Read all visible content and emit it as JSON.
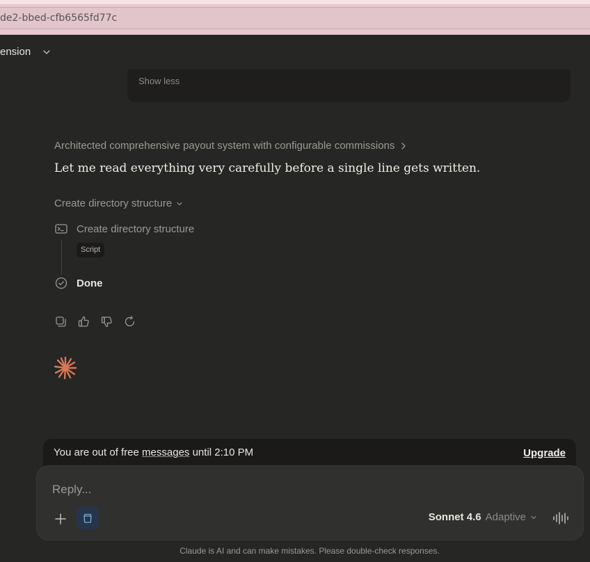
{
  "browser": {
    "url_fragment": "de2-bbed-cfb6565fd77c"
  },
  "header": {
    "project_label": "ension"
  },
  "previous_message": {
    "show_less_label": "Show less"
  },
  "assistant": {
    "thinking_summary": "Architected comprehensive payout system with configurable commissions",
    "message": "Let me read everything very carefully before a single line gets written.",
    "tool_group_label": "Create directory structure",
    "steps": [
      {
        "label": "Create directory structure",
        "tag": "Script",
        "icon": "terminal-icon"
      },
      {
        "label": "Done",
        "icon": "check-circle-icon"
      }
    ],
    "actions": [
      "copy-icon",
      "thumbs-up-icon",
      "thumbs-down-icon",
      "retry-icon"
    ]
  },
  "banner": {
    "text_prefix": "You are out of free ",
    "text_link": "messages",
    "text_suffix": " until 2:10 PM",
    "upgrade_label": "Upgrade"
  },
  "composer": {
    "placeholder": "Reply...",
    "model_name": "Sonnet 4.6",
    "model_mode": "Adaptive"
  },
  "footer": {
    "disclaimer": "Claude is AI and can make mistakes. Please double-check responses."
  },
  "colors": {
    "background": "#262624",
    "accent": "#d97757",
    "tool_button": "#263549"
  }
}
